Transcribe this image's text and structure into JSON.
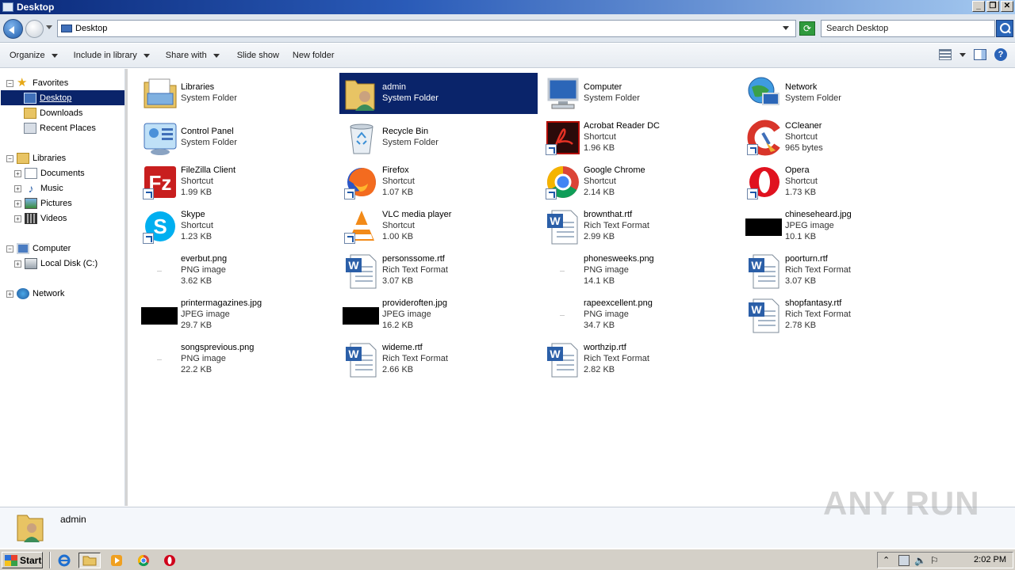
{
  "window": {
    "title": "Desktop"
  },
  "address": {
    "path": "Desktop",
    "search_placeholder": "Search Desktop"
  },
  "toolbar": {
    "organize": "Organize",
    "include_in_library": "Include in library",
    "share_with": "Share with",
    "slide_show": "Slide show",
    "new_folder": "New folder"
  },
  "nav": {
    "favorites": "Favorites",
    "desktop": "Desktop",
    "downloads": "Downloads",
    "recent_places": "Recent Places",
    "libraries": "Libraries",
    "documents": "Documents",
    "music": "Music",
    "pictures": "Pictures",
    "videos": "Videos",
    "computer": "Computer",
    "local_disk": "Local Disk (C:)",
    "network": "Network"
  },
  "items": [
    {
      "name": "Libraries",
      "type": "System Folder",
      "size": "",
      "icon": "libraries-icon"
    },
    {
      "name": "admin",
      "type": "System Folder",
      "size": "",
      "icon": "user-folder-icon"
    },
    {
      "name": "Computer",
      "type": "System Folder",
      "size": "",
      "icon": "computer-icon"
    },
    {
      "name": "Network",
      "type": "System Folder",
      "size": "",
      "icon": "network-icon"
    },
    {
      "name": "Control Panel",
      "type": "System Folder",
      "size": "",
      "icon": "control-panel-icon"
    },
    {
      "name": "Recycle Bin",
      "type": "System Folder",
      "size": "",
      "icon": "recycle-bin-icon"
    },
    {
      "name": "Acrobat Reader DC",
      "type": "Shortcut",
      "size": "1.96 KB",
      "icon": "acrobat-icon"
    },
    {
      "name": "CCleaner",
      "type": "Shortcut",
      "size": "965 bytes",
      "icon": "ccleaner-icon"
    },
    {
      "name": "FileZilla Client",
      "type": "Shortcut",
      "size": "1.99 KB",
      "icon": "filezilla-icon"
    },
    {
      "name": "Firefox",
      "type": "Shortcut",
      "size": "1.07 KB",
      "icon": "firefox-icon"
    },
    {
      "name": "Google Chrome",
      "type": "Shortcut",
      "size": "2.14 KB",
      "icon": "chrome-icon"
    },
    {
      "name": "Opera",
      "type": "Shortcut",
      "size": "1.73 KB",
      "icon": "opera-icon"
    },
    {
      "name": "Skype",
      "type": "Shortcut",
      "size": "1.23 KB",
      "icon": "skype-icon"
    },
    {
      "name": "VLC media player",
      "type": "Shortcut",
      "size": "1.00 KB",
      "icon": "vlc-icon"
    },
    {
      "name": "brownthat.rtf",
      "type": "Rich Text Format",
      "size": "2.99 KB",
      "icon": "word-doc-icon"
    },
    {
      "name": "chineseheard.jpg",
      "type": "JPEG image",
      "size": "10.1 KB",
      "icon": "jpeg-thumb-icon"
    },
    {
      "name": "everbut.png",
      "type": "PNG image",
      "size": "3.62 KB",
      "icon": "png-thumb-icon"
    },
    {
      "name": "personssome.rtf",
      "type": "Rich Text Format",
      "size": "3.07 KB",
      "icon": "word-doc-icon"
    },
    {
      "name": "phonesweeks.png",
      "type": "PNG image",
      "size": "14.1 KB",
      "icon": "png-thumb-icon"
    },
    {
      "name": "poorturn.rtf",
      "type": "Rich Text Format",
      "size": "3.07 KB",
      "icon": "word-doc-icon"
    },
    {
      "name": "printermagazines.jpg",
      "type": "JPEG image",
      "size": "29.7 KB",
      "icon": "jpeg-thumb-icon"
    },
    {
      "name": "provideroften.jpg",
      "type": "JPEG image",
      "size": "16.2 KB",
      "icon": "jpeg-thumb-icon"
    },
    {
      "name": "rapeexcellent.png",
      "type": "PNG image",
      "size": "34.7 KB",
      "icon": "png-thumb-icon"
    },
    {
      "name": "shopfantasy.rtf",
      "type": "Rich Text Format",
      "size": "2.78 KB",
      "icon": "word-doc-icon"
    },
    {
      "name": "songsprevious.png",
      "type": "PNG image",
      "size": "22.2 KB",
      "icon": "png-thumb-icon"
    },
    {
      "name": "wideme.rtf",
      "type": "Rich Text Format",
      "size": "2.66 KB",
      "icon": "word-doc-icon"
    },
    {
      "name": "worthzip.rtf",
      "type": "Rich Text Format",
      "size": "2.82 KB",
      "icon": "word-doc-icon"
    }
  ],
  "details": {
    "name": "admin"
  },
  "watermark": "ANY RUN",
  "taskbar": {
    "start": "Start",
    "clock": "2:02 PM"
  },
  "colors": {
    "selection": "#0a246a",
    "accent": "#2a63b8"
  }
}
